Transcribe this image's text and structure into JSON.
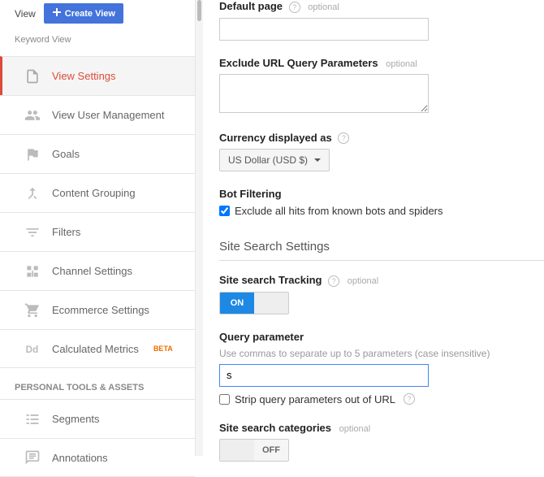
{
  "sidebar": {
    "view_label": "View",
    "create_view_label": "Create View",
    "view_name": "Keyword View",
    "items": [
      {
        "label": "View Settings"
      },
      {
        "label": "View User Management"
      },
      {
        "label": "Goals"
      },
      {
        "label": "Content Grouping"
      },
      {
        "label": "Filters"
      },
      {
        "label": "Channel Settings"
      },
      {
        "label": "Ecommerce Settings"
      },
      {
        "label": "Calculated Metrics",
        "badge": "BETA"
      }
    ],
    "tools_header": "PERSONAL TOOLS & ASSETS",
    "tools": [
      {
        "label": "Segments"
      },
      {
        "label": "Annotations"
      }
    ]
  },
  "form": {
    "default_page": {
      "label": "Default page",
      "optional": "optional",
      "value": ""
    },
    "exclude_url": {
      "label": "Exclude URL Query Parameters",
      "optional": "optional",
      "value": ""
    },
    "currency": {
      "label": "Currency displayed as",
      "value": "US Dollar (USD $)"
    },
    "bot_filtering": {
      "label": "Bot Filtering",
      "checkbox_label": "Exclude all hits from known bots and spiders",
      "checked": true
    },
    "site_search_section": "Site Search Settings",
    "site_search_tracking": {
      "label": "Site search Tracking",
      "optional": "optional",
      "state": "ON"
    },
    "query_param": {
      "label": "Query parameter",
      "helper": "Use commas to separate up to 5 parameters (case insensitive)",
      "value": "s"
    },
    "strip_query": {
      "label": "Strip query parameters out of URL",
      "checked": false
    },
    "site_search_categories": {
      "label": "Site search categories",
      "optional": "optional",
      "state": "OFF"
    }
  }
}
